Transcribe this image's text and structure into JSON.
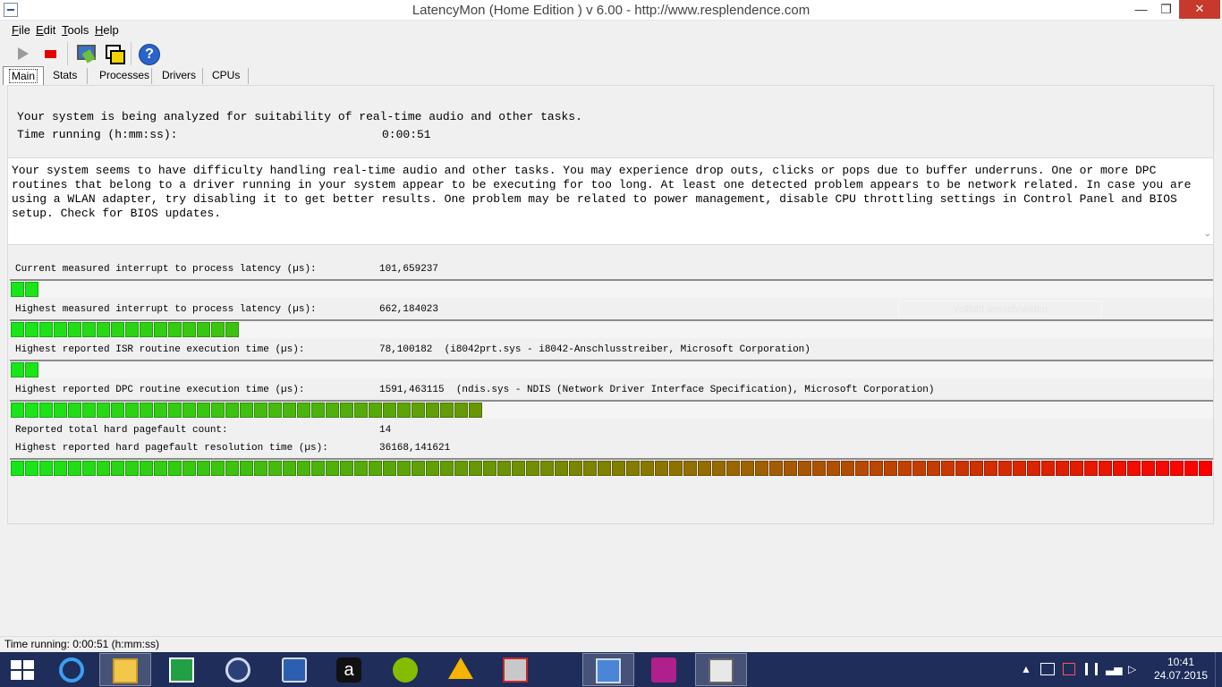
{
  "window": {
    "title": "LatencyMon  (Home Edition )  v 6.00 - http://www.resplendence.com",
    "minimize": "—",
    "maximize": "❐",
    "close": "✕"
  },
  "menu": [
    {
      "key": "F",
      "rest": "ile"
    },
    {
      "key": "E",
      "rest": "dit"
    },
    {
      "key": "T",
      "rest": "ools"
    },
    {
      "key": "H",
      "rest": "elp"
    }
  ],
  "toolbar": {
    "icons": [
      "play-icon",
      "stop-icon",
      "monitor-icon",
      "windows-icon",
      "help-icon"
    ]
  },
  "tabs": [
    {
      "label": "Main",
      "active": true
    },
    {
      "label": "Stats",
      "active": false
    },
    {
      "label": "Processes",
      "active": false
    },
    {
      "label": "Drivers",
      "active": false
    },
    {
      "label": "CPUs",
      "active": false
    }
  ],
  "main": {
    "analyzing": "Your system is being analyzed for suitability of real-time audio and other tasks.",
    "time_running_label": "Time running (h:mm:ss):",
    "time_running_value": "0:00:51",
    "conclusion": "Your system seems to have difficulty handling real-time audio and other tasks. You may experience drop outs, clicks or pops due to buffer underruns. One or more DPC routines that belong to a driver running in your system appear to be executing for too long. At least one detected problem appears to be network related. In case you are using a WLAN adapter, try disabling it to get better results. One problem may be related to power management, disable CPU throttling settings in Control Panel and BIOS setup. Check for BIOS updates.",
    "scroll_down": "⌄",
    "metrics": [
      {
        "label": "Current measured interrupt to process latency (µs):",
        "value": "101,659237",
        "segments": 2
      },
      {
        "label": "Highest measured interrupt to process latency (µs):",
        "value": "662,184023",
        "segments": 16
      },
      {
        "label": "Highest reported ISR routine execution time (µs):",
        "value": "78,100182  (i8042prt.sys - i8042-Anschlusstreiber, Microsoft Corporation)",
        "segments": 2
      },
      {
        "label": "Highest reported DPC routine execution time (µs):",
        "value": "1591,463115  (ndis.sys - NDIS (Network Driver Interface Specification), Microsoft Corporation)",
        "segments": 33
      }
    ],
    "pagefault_count_label": "Reported total hard pagefault count:",
    "pagefault_count_value": "14",
    "pagefault_time_label": "Highest reported hard pagefault resolution time (µs):",
    "pagefault_time_value": "36168,141621",
    "pagefault_segments": 84,
    "ghost_tooltip": "Vollbild ausschneiden"
  },
  "statusbar": {
    "text": "Time running: 0:00:51  (h:mm:ss)"
  },
  "taskbar": {
    "apps": [
      "internet-explorer-icon",
      "file-explorer-icon",
      "store-icon",
      "calculator-icon",
      "messaging-icon",
      "amazon-icon",
      "spotify-icon",
      "drive-icon",
      "remote-desktop-icon",
      "control-panel-icon",
      "camera-icon",
      "latencymon-icon"
    ],
    "time": "10:41",
    "date": "24.07.2015"
  },
  "colors": {
    "bar_green": "#19e61a",
    "bar_red": "#ff0000",
    "taskbar": "#1e2d5a"
  }
}
